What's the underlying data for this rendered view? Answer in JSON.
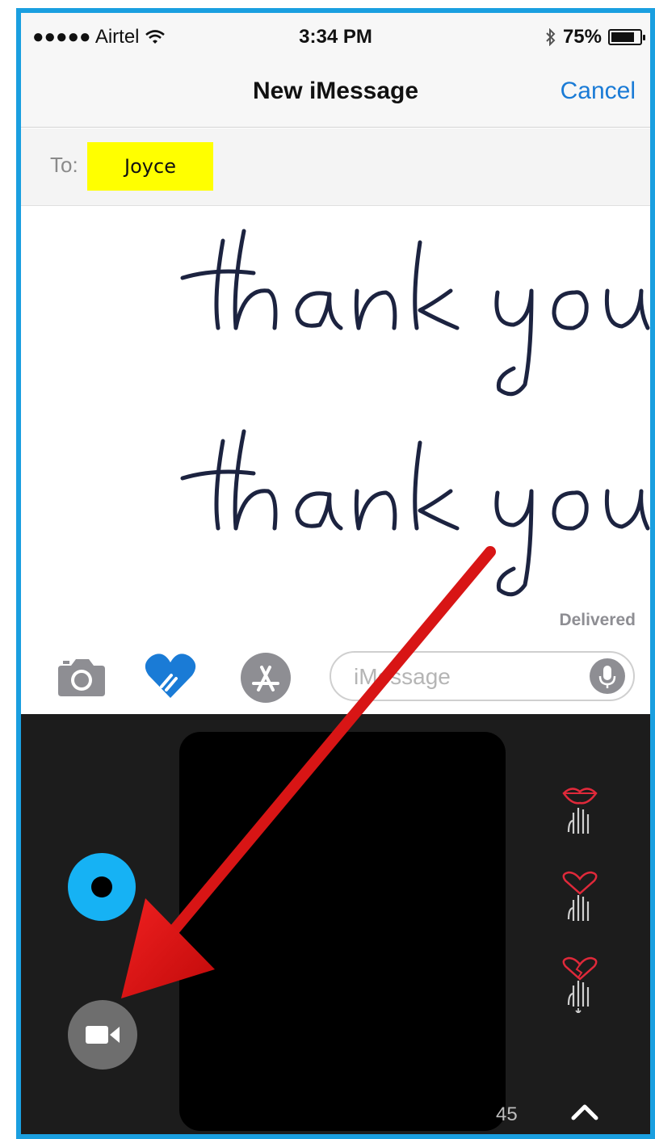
{
  "status_bar": {
    "carrier": "●●●●● Airtel",
    "time": "3:34 PM",
    "battery": "75%"
  },
  "nav": {
    "title": "New iMessage",
    "cancel_label": "Cancel"
  },
  "recipient": {
    "label": "To:",
    "name": "Joyce"
  },
  "message": {
    "handwritten_text": "thank you thank you",
    "status": "Delivered"
  },
  "input": {
    "placeholder": "iMessage"
  },
  "icons": {
    "camera": "camera-icon",
    "digital_touch": "heart-hands-icon",
    "app_store": "app-store-icon",
    "microphone": "microphone-icon",
    "video": "video-camera-icon",
    "gesture_kiss": "kiss-gesture-icon",
    "gesture_heartbeat": "heartbeat-gesture-icon",
    "gesture_heartbreak": "heartbreak-gesture-icon",
    "expand": "chevron-up-icon"
  },
  "panel": {
    "page_number": "45"
  },
  "colors": {
    "accent_blue": "#1a7bd6",
    "frame_border": "#1a9fe0",
    "color_picker": "#16b2f4",
    "highlight": "#ffff00",
    "arrow_red": "#e01010"
  }
}
